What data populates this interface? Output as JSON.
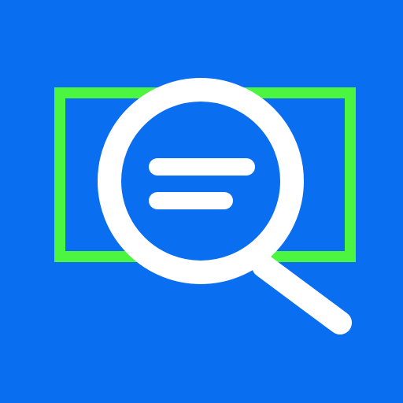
{
  "icon": {
    "name": "search-document-app-icon",
    "glyph": "magnifying-glass-icon",
    "target": "document-frame-icon",
    "content": "text-lines-icon"
  },
  "colors": {
    "background": "#0A6EF0",
    "frame": "#4CF53F",
    "glyph": "#FFFFFF"
  }
}
